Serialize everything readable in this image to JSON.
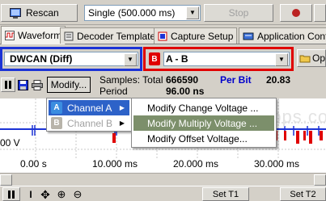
{
  "toolbar": {
    "rescan_label": "Rescan",
    "timebase_value": "Single (500.000 ms)",
    "stop_label": "Stop"
  },
  "tabs": [
    {
      "label": "Waveform",
      "icon": "waveform-icon",
      "active": true
    },
    {
      "label": "Decoder Templates",
      "icon": "decoder-icon",
      "active": false
    },
    {
      "label": "Capture Setup",
      "icon": "capture-icon",
      "active": false
    },
    {
      "label": "Application Confi",
      "icon": "app-config-icon",
      "active": false
    }
  ],
  "channel_a": {
    "badge": "A",
    "value": "DWCAN (Diff)",
    "color": "#1c33d6"
  },
  "channel_b": {
    "badge": "B",
    "value": "A - B",
    "color": "#e00000"
  },
  "open_label": "Op",
  "info": {
    "modify_label": "Modify...",
    "samples_label": "Samples: Total",
    "samples_value": "666590",
    "per_bit_label": "Per Bit",
    "per_bit_value": "20.83",
    "period_label": "Period",
    "period_value": "96.00 ns"
  },
  "scope": {
    "voltage_label": "00 V",
    "watermark": "ebps.co",
    "time_ticks": [
      "0.00 s",
      "10.000 ms",
      "20.000 ms",
      "30.000 ms"
    ]
  },
  "menu_channel": [
    {
      "badge": "A",
      "label": "Channel A",
      "selected": true,
      "enabled": true
    },
    {
      "badge": "B",
      "label": "Channel B",
      "selected": false,
      "enabled": false
    }
  ],
  "menu_modify": [
    {
      "label": "Modify Change Voltage ...",
      "selected": false
    },
    {
      "label": "Modify Multiply Voltage ...",
      "selected": true
    },
    {
      "label": "Modify Offset Voltage...",
      "selected": false
    }
  ],
  "bottom": {
    "set_t1_label": "Set T1",
    "set_t2_label": "Set T2"
  },
  "colors": {
    "channel_a": "#1c33d6",
    "channel_b": "#e00000",
    "per_bit": "#0000cc",
    "menu_highlight": "#7c8f6b"
  }
}
